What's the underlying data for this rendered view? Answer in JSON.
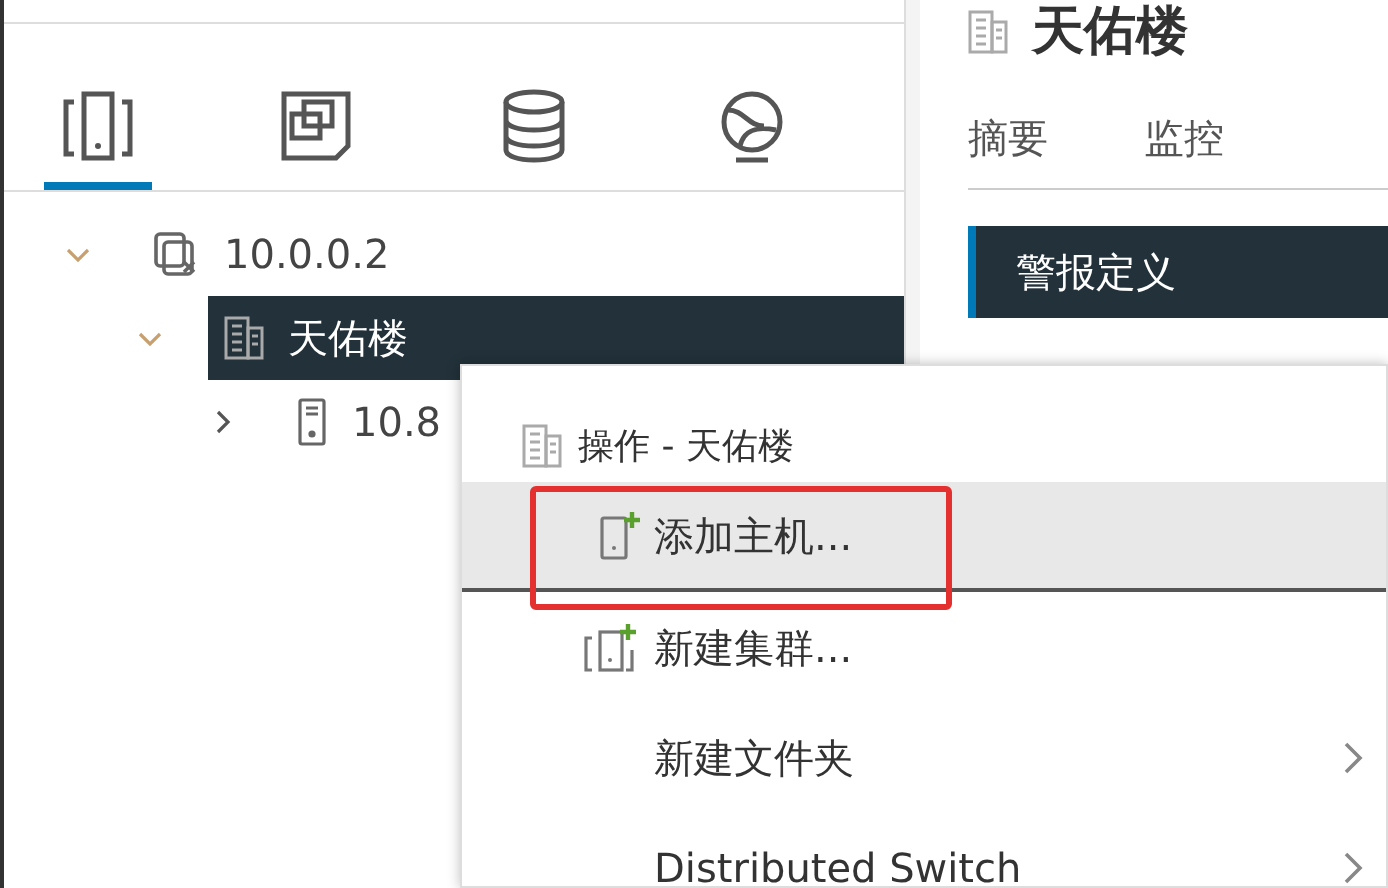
{
  "view_tabs": [
    {
      "kind": "hosts",
      "selected": true
    },
    {
      "kind": "vms",
      "selected": false
    },
    {
      "kind": "storage",
      "selected": false
    },
    {
      "kind": "network",
      "selected": false
    }
  ],
  "tree": [
    {
      "label": "10.0.0.2",
      "kind": "vcenter",
      "expanded": true,
      "selected": false,
      "children": [
        {
          "label": "天佑楼",
          "kind": "datacenter",
          "expanded": true,
          "selected": true,
          "children": [
            {
              "label": "10.8",
              "kind": "host",
              "expanded": false,
              "selected": false
            }
          ]
        }
      ]
    }
  ],
  "header": {
    "title": "天佑楼"
  },
  "tabs": [
    {
      "label": "摘要",
      "selected": false
    },
    {
      "label": "监控",
      "selected": false
    }
  ],
  "nav": [
    {
      "label": "警报定义",
      "selected": true
    }
  ],
  "context_menu": {
    "title": "操作 - 天佑楼",
    "items": [
      {
        "label": "添加主机...",
        "kind": "add-host",
        "hovered": true,
        "highlighted": true,
        "submenu": false
      },
      {
        "label": "新建集群...",
        "kind": "add-cluster",
        "hovered": false,
        "highlighted": false,
        "submenu": false
      },
      {
        "label": "新建文件夹",
        "kind": "plain",
        "hovered": false,
        "highlighted": false,
        "submenu": true
      },
      {
        "label": "Distributed Switch",
        "kind": "plain",
        "hovered": false,
        "highlighted": false,
        "submenu": true
      }
    ]
  }
}
